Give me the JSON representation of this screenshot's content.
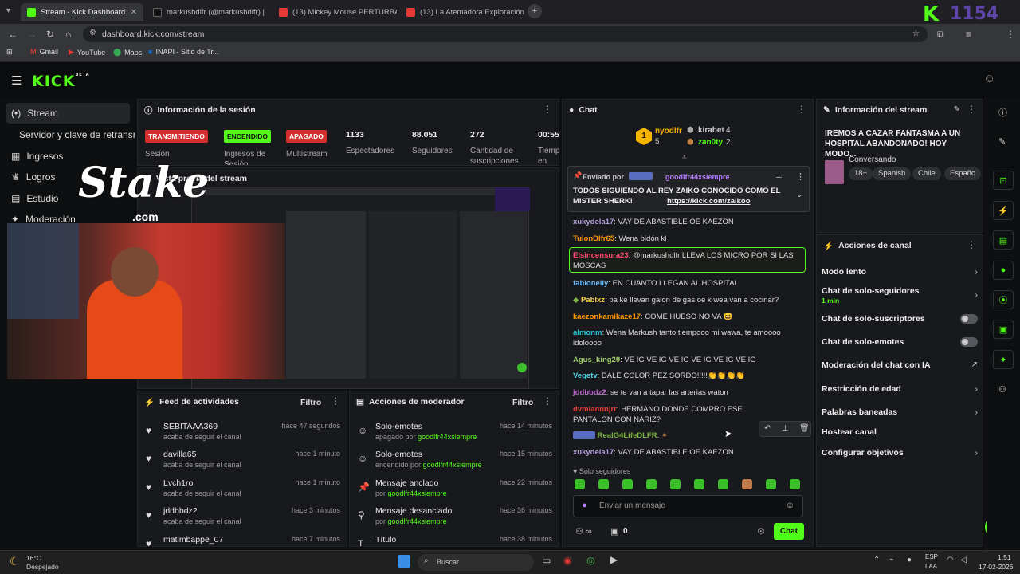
{
  "browser": {
    "tabs": [
      {
        "label": "Stream - Kick Dashboard",
        "active": true
      },
      {
        "label": "markushdlfr (@markushdlfr) |"
      },
      {
        "label": "(13) Mickey Mouse PERTURBA"
      },
      {
        "label": "(13) La Atemadora Exploración"
      }
    ],
    "url": "dashboard.kick.com/stream",
    "bookmarks": [
      "Gmail",
      "YouTube",
      "Maps",
      "INAPI - Sitio de Tr..."
    ],
    "corner_overlay": "1154"
  },
  "kick": {
    "logo": "KICK",
    "logo_beta": "BETA"
  },
  "sidebar": {
    "items": [
      {
        "icon": "(•)",
        "label": "Stream"
      },
      {
        "icon": "",
        "label": "Servidor y clave de retransmisión"
      },
      {
        "icon": "▦",
        "label": "Ingresos"
      },
      {
        "icon": "♛",
        "label": "Logros"
      },
      {
        "icon": "▤",
        "label": "Estudio"
      },
      {
        "icon": "✦",
        "label": "Moderación"
      }
    ]
  },
  "overlay": {
    "stake": "Stake",
    "stake_com": ".com"
  },
  "session": {
    "title": "Información de la sesión",
    "badges": [
      {
        "label": "TRANSMITIENDO",
        "color": "#d32f2f",
        "caption": "Sesión"
      },
      {
        "label": "ENCENDIDO",
        "color": "#53fc18",
        "caption": "Ingresos de Sesión"
      },
      {
        "label": "APAGADO",
        "color": "#d32f2f",
        "caption": "Multistream"
      }
    ],
    "stats": [
      {
        "value": "1133",
        "label": "Espectadores"
      },
      {
        "value": "88.051",
        "label": "Seguidores"
      },
      {
        "value": "272",
        "label": "Cantidad de suscripciones"
      },
      {
        "value": "00:55:",
        "label": "Tiempo en vivo"
      }
    ]
  },
  "preview": {
    "title": "Vista previa del stream"
  },
  "feed": {
    "title": "Feed de actividades",
    "filter": "Filtro",
    "rows": [
      {
        "name": "SEBITAAA369",
        "action": "acaba de seguir el canal",
        "time": "hace 47 segundos"
      },
      {
        "name": "davilla65",
        "action": "acaba de seguir el canal",
        "time": "hace 1 minuto"
      },
      {
        "name": "Lvch1ro",
        "action": "acaba de seguir el canal",
        "time": "hace 1 minuto"
      },
      {
        "name": "jddbbdz2",
        "action": "acaba de seguir el canal",
        "time": "hace 3 minutos"
      },
      {
        "name": "matimbappe_07",
        "action": "",
        "time": "hace 7 minutos"
      }
    ]
  },
  "modactions": {
    "title": "Acciones de moderador",
    "filter": "Filtro",
    "rows": [
      {
        "icon": "☺",
        "title": "Solo-emotes",
        "prefix": "apagado por",
        "by": "goodlfr44xsiempre",
        "time": "hace 14 minutos"
      },
      {
        "icon": "☺",
        "title": "Solo-emotes",
        "prefix": "encendido por",
        "by": "goodlfr44xsiempre",
        "time": "hace 15 minutos"
      },
      {
        "icon": "📌",
        "title": "Mensaje anclado",
        "prefix": "por",
        "by": "goodlfr44xsiempre",
        "time": "hace 22 minutos"
      },
      {
        "icon": "⚲",
        "title": "Mensaje desanclado",
        "prefix": "por",
        "by": "goodlfr44xsiempre",
        "time": "hace 36 minutos"
      },
      {
        "icon": "T",
        "title": "Título",
        "prefix": "",
        "by": "",
        "time": "hace 38 minutos"
      }
    ]
  },
  "chat": {
    "title": "Chat",
    "leaders": [
      {
        "name": "nyodlfr",
        "count": "5",
        "rank": "1"
      },
      {
        "name": "kirabet",
        "count": "4"
      },
      {
        "name": "zan0ty",
        "count": "2"
      }
    ],
    "pinned": {
      "sent_by": "Enviado por",
      "user": "goodlfr44xsiempre",
      "text": "TODOS SIGUIENDO AL REY ZAIKO CONOCIDO COMO EL MISTER SHERK!",
      "link": "https://kick.com/zaikoo"
    },
    "messages": [
      {
        "user": "xukydela17",
        "color": "#b39ddb",
        "text": "VAY DE ABASTIBLE OE KAEZON"
      },
      {
        "user": "TulonDlfr65",
        "color": "#ff9800",
        "text": "Wena bidón kl"
      },
      {
        "user": "Elsincensura23",
        "color": "#ff4d6d",
        "text": "@markushdlfr LLEVA LOS MICRO POR SI LAS MOSCAS"
      },
      {
        "user": "fabionelly",
        "color": "#64b5f6",
        "text": "EN CUANTO LLEGAN AL HOSPITAL"
      },
      {
        "user": "Pablxz",
        "color": "#ffd54f",
        "text": "pa ke llevan galon de gas oe k wea van a cocinar?"
      },
      {
        "user": "kaezonkamikaze17",
        "color": "#ff9800",
        "text": "COME HUESO NO VA 😆"
      },
      {
        "user": "almonm",
        "color": "#26c6da",
        "text": "Wena Markush tanto tiempooo mi wawa, te amoooo idoloooo"
      },
      {
        "user": "Agus_king29",
        "color": "#9ccc65",
        "text": "VE IG VE IG VE IG VE IG VE IG VE IG"
      },
      {
        "user": "Vegetv",
        "color": "#4dd0e1",
        "text": "DALE COLOR PEZ SORDO!!!!!👏👏👏👏"
      },
      {
        "user": "jddbbdz2",
        "color": "#ba68c8",
        "text": "se te van a tapar las arterias waton"
      },
      {
        "user": "dvmiannnjrr",
        "color": "#e53935",
        "text": "HERMANO DONDE COMPRO ESE PANTALON CON NARIZ?"
      },
      {
        "user": "RealG4LifeDLFR",
        "color": "#7cb342",
        "text": ""
      },
      {
        "user": "xukydela17",
        "color": "#b39ddb",
        "text": "VAY DE ABASTIBLE OE KAEZON"
      }
    ],
    "mode": "Solo seguidores",
    "placeholder": "Enviar un mensaje",
    "count": "0",
    "send": "Chat"
  },
  "stream_info": {
    "title": "Información del stream",
    "stream_title": "IREMOS A CAZAR FANTASMA A UN HOSPITAL ABANDONADO! HOY MODO...",
    "category": "Conversando",
    "tags": [
      "18+",
      "Spanish",
      "Chile",
      "Españo"
    ]
  },
  "channel_actions": {
    "title": "Acciones de canal",
    "items": [
      {
        "label": "Modo lento",
        "kind": "chevron"
      },
      {
        "label": "Chat de solo-seguidores",
        "sub": "1 min",
        "kind": "chevron"
      },
      {
        "label": "Chat de solo-suscriptores",
        "kind": "toggle"
      },
      {
        "label": "Chat de solo-emotes",
        "kind": "toggle"
      },
      {
        "label": "Moderación del chat con IA",
        "kind": "external"
      },
      {
        "label": "Restricción de edad",
        "kind": "chevron"
      },
      {
        "label": "Palabras baneadas",
        "kind": "chevron"
      },
      {
        "label": "Hostear canal",
        "kind": "none"
      },
      {
        "label": "Configurar objetivos",
        "kind": "chevron"
      }
    ]
  },
  "taskbar": {
    "weather_temp": "16°C",
    "weather_desc": "Despejado",
    "search": "Buscar",
    "lang": "ESP",
    "lang2": "LAA",
    "time": "1:51",
    "date": "17-02-2026"
  },
  "colors": {
    "accent": "#53fc18",
    "live": "#d32f2f",
    "panel": "#18191c"
  }
}
